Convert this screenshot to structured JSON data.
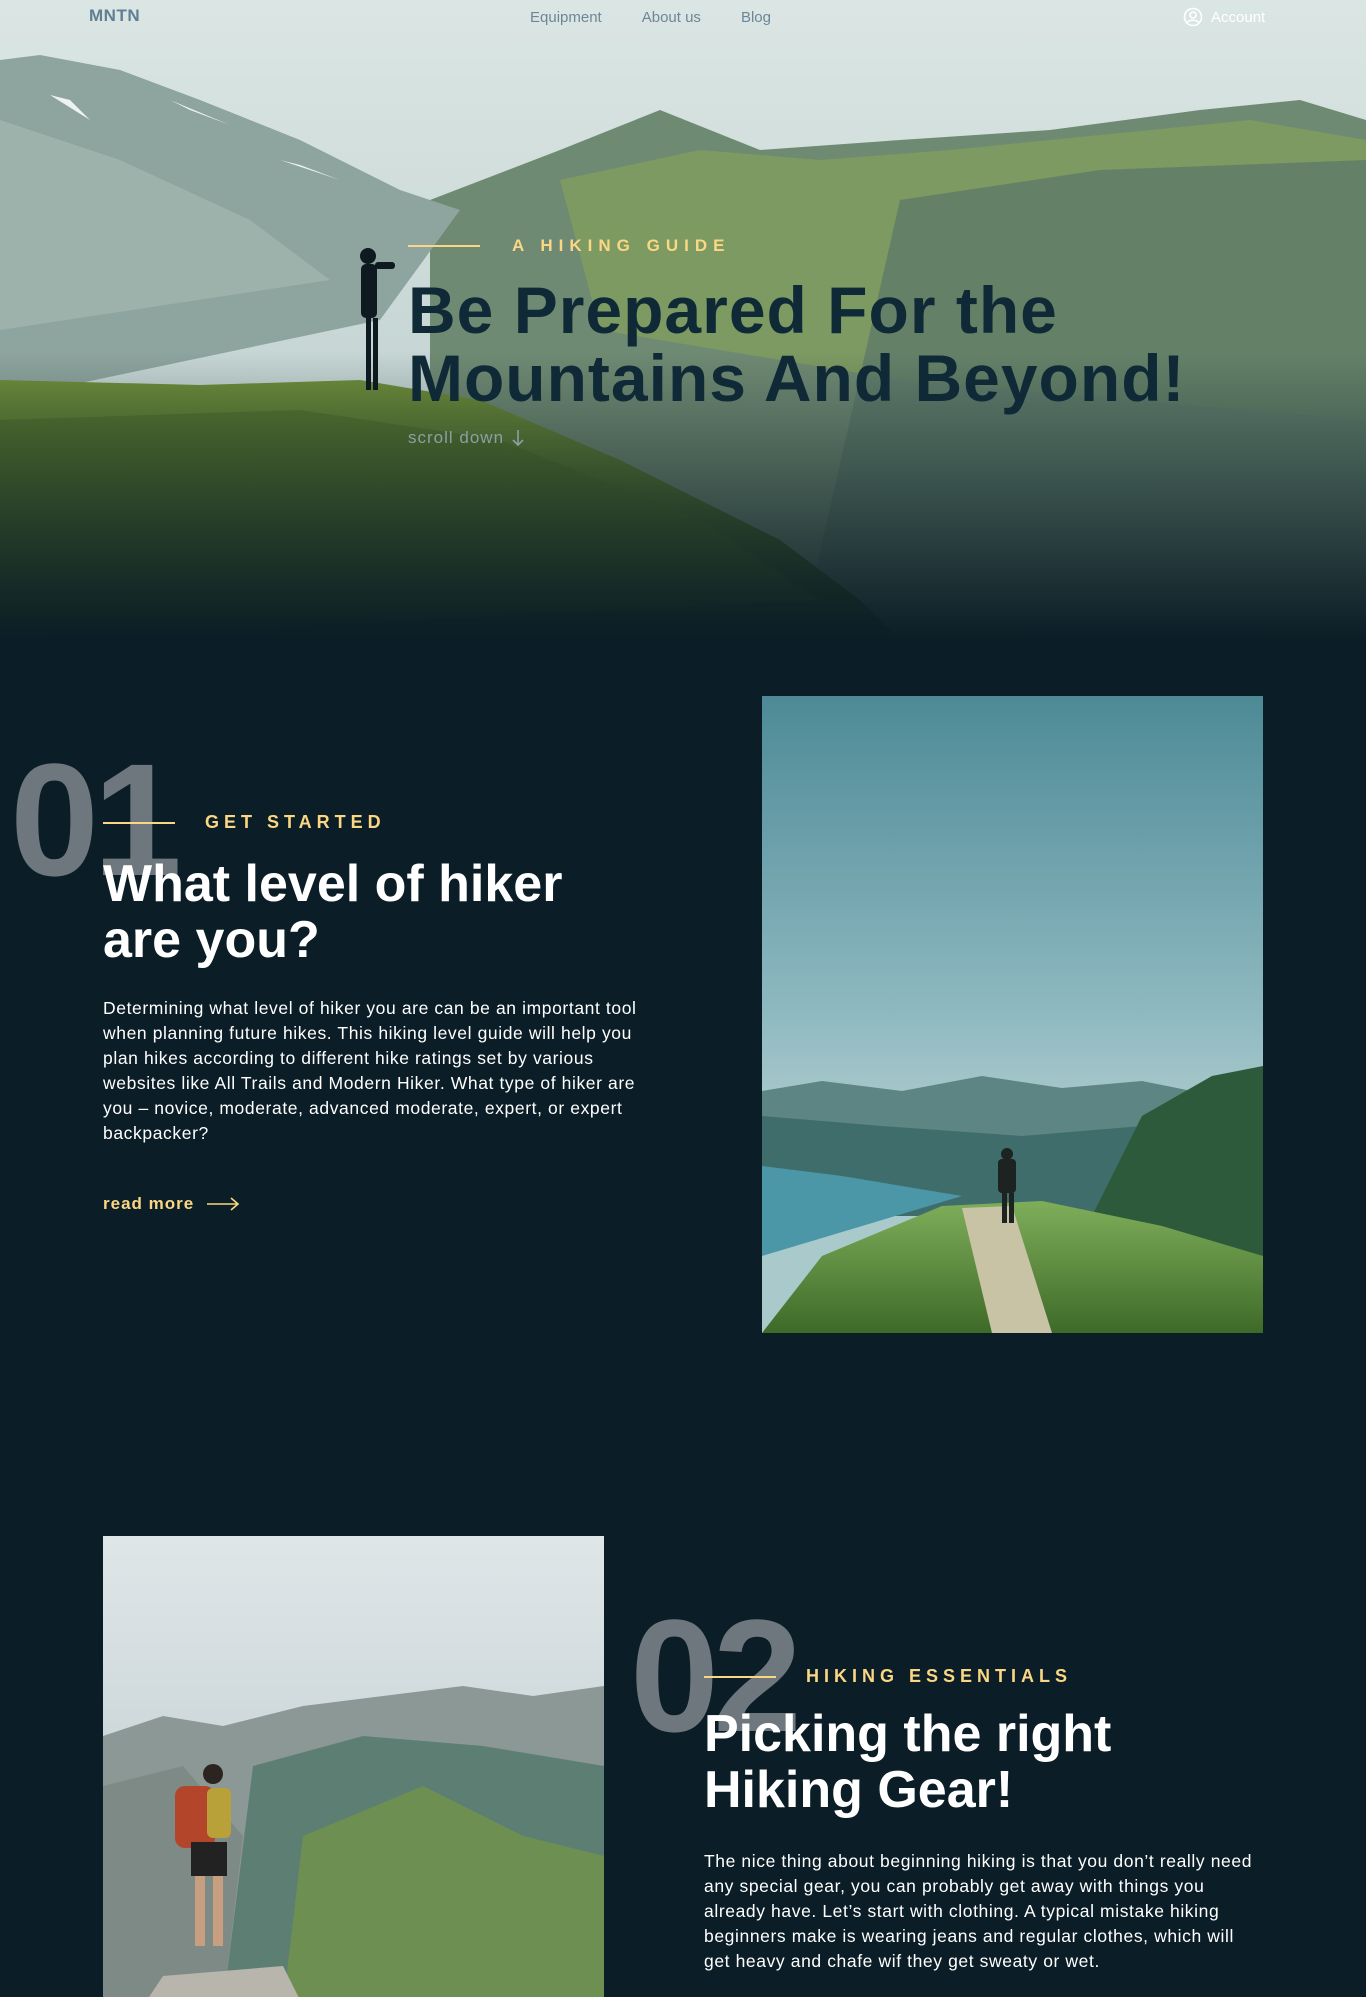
{
  "nav": {
    "logo": "MNTN",
    "links": [
      "Equipment",
      "About us",
      "Blog"
    ],
    "account_label": "Account",
    "account_icon": "user-circle-icon"
  },
  "hero": {
    "eyebrow": "A HIKING GUIDE",
    "title_line1": "Be Prepared For the",
    "title_line2": "Mountains And Beyond!",
    "scroll_label": "scroll down",
    "scroll_icon": "arrow-down-icon"
  },
  "sections": [
    {
      "number": "01",
      "eyebrow": "GET STARTED",
      "title_line1": "What level of hiker",
      "title_line2": "are you?",
      "body": "Determining what level of hiker you are can be an important tool when planning future hikes. This hiking level guide will help you plan hikes according to different hike ratings set by various websites like All Trails and Modern Hiker. What type of hiker are you – novice, moderate, advanced moderate, expert, or expert backpacker?",
      "link": "read more"
    },
    {
      "number": "02",
      "eyebrow": "HIKING ESSENTIALS",
      "title_line1": "Picking the right",
      "title_line2": "Hiking Gear!",
      "body": "The nice thing about beginning hiking is that you don’t really need any special gear, you can probably get away with things you already have. Let’s start with clothing. A typical mistake hiking beginners make is wearing jeans and regular clothes, which will get heavy and chafe wif they get sweaty or wet."
    }
  ],
  "colors": {
    "background": "#0b1d26",
    "accent": "#fbd784",
    "hero_title": "#0f2a36"
  }
}
